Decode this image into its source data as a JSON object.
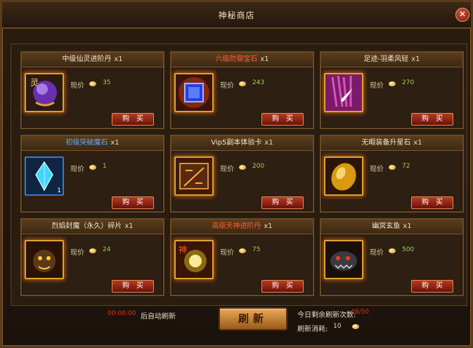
{
  "window": {
    "title": "神秘商店",
    "close_icon": "close-icon"
  },
  "price_label": "现价",
  "buy_label": "购　买",
  "items": [
    {
      "name": "中级仙灵进阶丹",
      "qty": "x1",
      "price": "35",
      "name_color": "#f0e6cf",
      "icon": "purple-orb-icon"
    },
    {
      "name": "六级防御宝石",
      "qty": "x1",
      "price": "243",
      "name_color": "#ff5a32",
      "icon": "blue-gem-icon"
    },
    {
      "name": "足迹-羽柔风轻",
      "qty": "x1",
      "price": "270",
      "name_color": "#f0e6cf",
      "icon": "feather-icon"
    },
    {
      "name": "初级突破魔石",
      "qty": "x1",
      "price": "1",
      "name_color": "#5fa8ff",
      "icon": "crystal-icon",
      "stack": "1"
    },
    {
      "name": "Vip5副本体验卡",
      "qty": "x1",
      "price": "200",
      "name_color": "#f0e6cf",
      "icon": "vip-card-icon"
    },
    {
      "name": "无暇装备升星石",
      "qty": "x1",
      "price": "72",
      "name_color": "#f0e6cf",
      "icon": "gold-stone-icon"
    },
    {
      "name": "烈焰封魔（永久）碎片",
      "qty": "x1",
      "price": "24",
      "name_color": "#f0e6cf",
      "icon": "demon-fragment-icon"
    },
    {
      "name": "高级天神进阶丹",
      "qty": "x1",
      "price": "75",
      "name_color": "#ff5a32",
      "icon": "golden-pill-icon"
    },
    {
      "name": "幽冥玄鱼",
      "qty": "x1",
      "price": "500",
      "name_color": "#f0e6cf",
      "icon": "dark-fish-icon"
    }
  ],
  "footer": {
    "timer": "00:00:00",
    "auto_refresh_text": "后自动刷新",
    "refresh_button": "刷新",
    "refresh_count_label": "今日剩余刷新次数:",
    "refresh_count_value": "48/50",
    "refresh_cost_label": "刷新消耗:",
    "refresh_cost_value": "10"
  }
}
